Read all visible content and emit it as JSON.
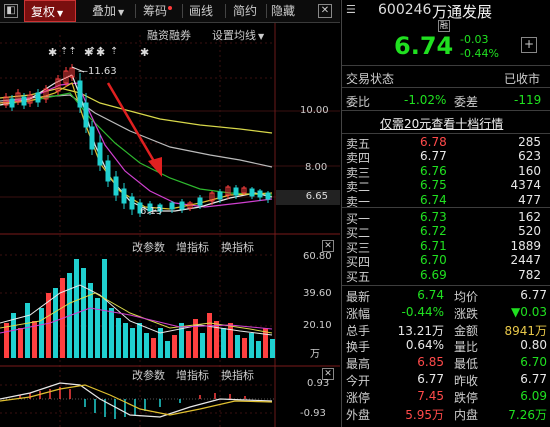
{
  "toolbar": {
    "fuquan": "复权",
    "diejia": "叠加",
    "chouma": "筹码",
    "huaxian": "画线",
    "jianyue": "简约",
    "yincang": "隐藏"
  },
  "chart": {
    "rongzi": "融资融券",
    "shezhi": "设置均线",
    "high_label": "11.63",
    "low_label": "6.13",
    "yaxis": [
      "10.00",
      "8.00",
      "6.65"
    ],
    "vol_yaxis": [
      "60.80",
      "39.60",
      "20.10",
      "万"
    ],
    "macd_yaxis": [
      "0.93",
      "-0.93"
    ],
    "gaicanshu": "改参数",
    "zengzhibiao": "增指标",
    "huanzhibiao": "换指标"
  },
  "quote": {
    "code": "600246",
    "name": "万通发展",
    "badge": "融",
    "price": "6.74",
    "change": "-0.03",
    "change_pct": "-0.44%",
    "status_label": "交易状态",
    "status_value": "已收市",
    "weibi_label": "委比",
    "weibi_value": "-1.02%",
    "weicha_label": "委差",
    "weicha_value": "-119",
    "promo": "仅需20元查看十档行情"
  },
  "order_book": {
    "asks": [
      {
        "label": "卖五",
        "price": "6.78",
        "vol": "285"
      },
      {
        "label": "卖四",
        "price": "6.77",
        "vol": "623"
      },
      {
        "label": "卖三",
        "price": "6.76",
        "vol": "160"
      },
      {
        "label": "卖二",
        "price": "6.75",
        "vol": "4374"
      },
      {
        "label": "卖一",
        "price": "6.74",
        "vol": "477"
      }
    ],
    "bids": [
      {
        "label": "买一",
        "price": "6.73",
        "vol": "162"
      },
      {
        "label": "买二",
        "price": "6.72",
        "vol": "520"
      },
      {
        "label": "买三",
        "price": "6.71",
        "vol": "1889"
      },
      {
        "label": "买四",
        "price": "6.70",
        "vol": "2447"
      },
      {
        "label": "买五",
        "price": "6.69",
        "vol": "782"
      }
    ]
  },
  "stats": [
    {
      "l1": "最新",
      "v1": "6.74",
      "l2": "均价",
      "v2": "6.77"
    },
    {
      "l1": "涨幅",
      "v1": "-0.44%",
      "l2": "涨跌",
      "v2": "▼0.03"
    },
    {
      "l1": "总手",
      "v1": "13.21万",
      "l2": "金额",
      "v2": "8941万"
    },
    {
      "l1": "换手",
      "v1": "0.64%",
      "l2": "量比",
      "v2": "0.80"
    },
    {
      "l1": "最高",
      "v1": "6.85",
      "l2": "最低",
      "v2": "6.70"
    },
    {
      "l1": "今开",
      "v1": "6.77",
      "l2": "昨收",
      "v2": "6.77"
    },
    {
      "l1": "涨停",
      "v1": "7.45",
      "l2": "跌停",
      "v2": "6.09"
    },
    {
      "l1": "外盘",
      "v1": "5.95万",
      "l2": "内盘",
      "v2": "7.26万"
    }
  ]
}
